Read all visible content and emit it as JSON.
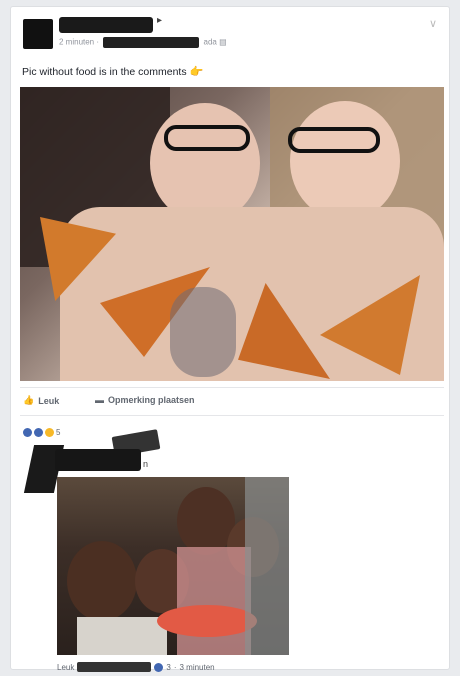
{
  "post": {
    "time_label": "2 minuten",
    "meta_tail": "ada",
    "name_tail": "▸",
    "text": "Pic without food is in the comments",
    "emoji": "👉",
    "chevron": "∨"
  },
  "actions": {
    "like_label": "Leuk",
    "comment_label": "Opmerking plaatsen"
  },
  "reactions": {
    "count": "5"
  },
  "comment": {
    "name_tail": "n",
    "like_label": "Leuk",
    "reaction_count": "3",
    "time_label": "3 minuten"
  },
  "colors": {
    "facebook_blue": "#4267b2",
    "link_gray": "#616770",
    "background": "#e9ebee"
  }
}
